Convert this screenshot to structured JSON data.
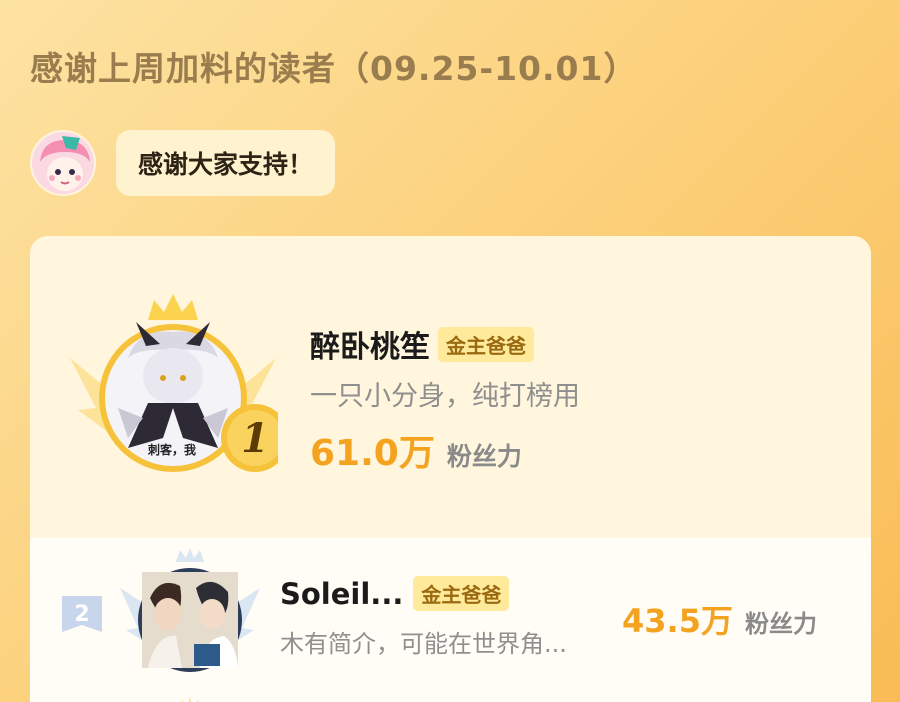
{
  "header": {
    "title": "感谢上周加料的读者（09.25-10.01）"
  },
  "mascot": {
    "message": "感谢大家支持！"
  },
  "leaderboard": [
    {
      "rank": "1",
      "name": "醉卧桃笙",
      "badge": "金主爸爸",
      "bio": "一只小分身，纯打榜用",
      "score": "61.0万",
      "score_unit": "粉丝力",
      "avatar_caption": "刺客，我"
    },
    {
      "rank": "2",
      "name": "Soleil...",
      "badge": "金主爸爸",
      "bio": "木有简介，可能在世界角...",
      "score": "43.5万",
      "score_unit": "粉丝力"
    }
  ],
  "colors": {
    "background_start": "#fde3a3",
    "background_end": "#f9bc55",
    "score": "#f4a321",
    "badge_bg": "#ffe99a",
    "badge_text": "#9a6a10",
    "gold": "#f6c23a"
  }
}
